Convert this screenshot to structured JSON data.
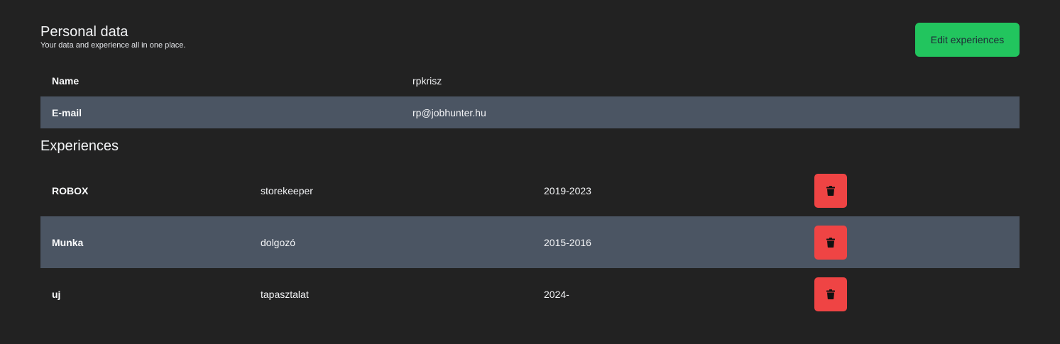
{
  "header": {
    "title": "Personal data",
    "subtitle": "Your data and experience all in one place.",
    "edit_button_label": "Edit experiences"
  },
  "personal": [
    {
      "label": "Name",
      "value": "rpkrisz"
    },
    {
      "label": "E-mail",
      "value": "rp@jobhunter.hu"
    }
  ],
  "experiences_title": "Experiences",
  "experiences": [
    {
      "company": "ROBOX",
      "position": "storekeeper",
      "years": "2019-2023",
      "delete_icon": "trash-icon"
    },
    {
      "company": "Munka",
      "position": "dolgozó",
      "years": "2015-2016",
      "delete_icon": "trash-icon"
    },
    {
      "company": "uj",
      "position": "tapasztalat",
      "years": "2024-",
      "delete_icon": "trash-icon"
    }
  ],
  "colors": {
    "background": "#222222",
    "row_alt": "#4b5563",
    "accent_green": "#22c55e",
    "danger_red": "#ef4444"
  }
}
